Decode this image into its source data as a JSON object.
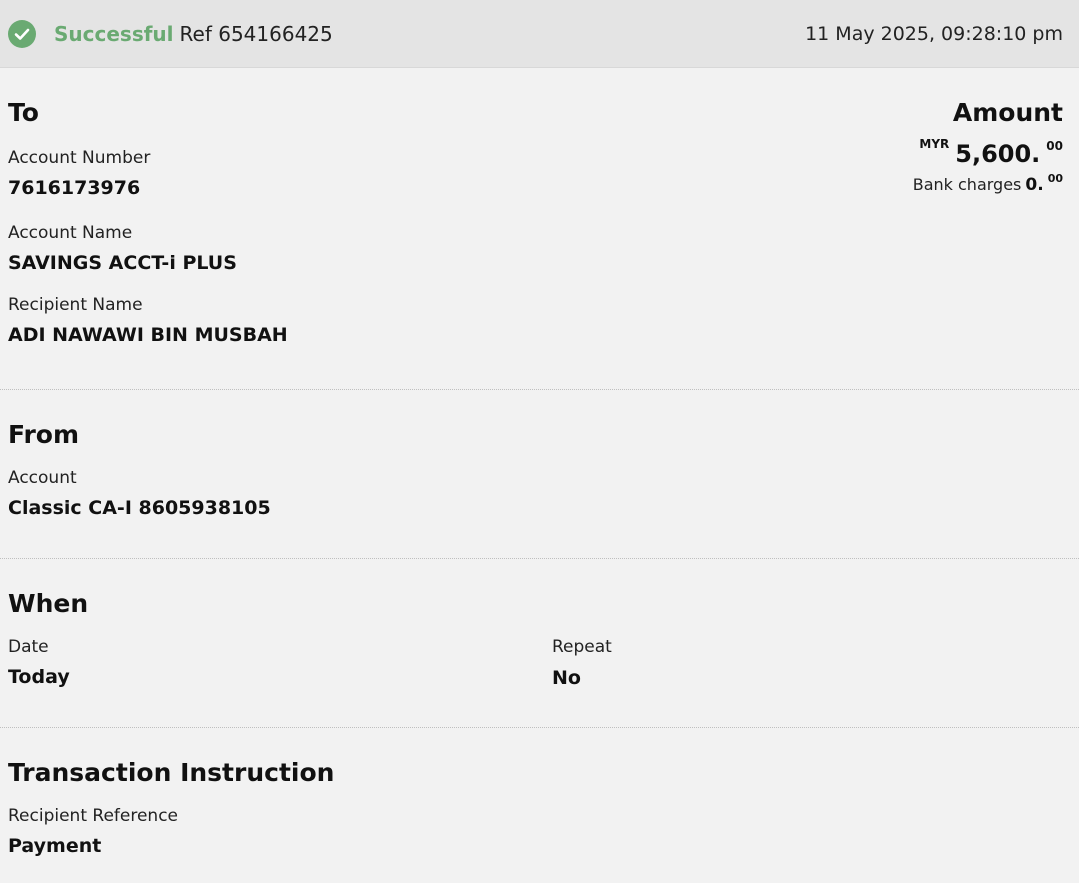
{
  "header": {
    "status": "Successful",
    "ref": "Ref 654166425",
    "datetime": "11 May 2025, 09:28:10 pm",
    "status_color": "#6aaa72",
    "status_icon": "check-circle-icon"
  },
  "to": {
    "title": "To",
    "account_number_label": "Account Number",
    "account_number": "7616173976",
    "account_name_label": "Account Name",
    "account_name": "SAVINGS ACCT-i PLUS",
    "recipient_name_label": "Recipient Name",
    "recipient_name": "ADI NAWAWI BIN MUSBAH"
  },
  "amount": {
    "title": "Amount",
    "currency": "MYR",
    "value": "5,600.",
    "cents": "00",
    "charges_label": "Bank charges",
    "charges_value": "0.",
    "charges_cents": "00"
  },
  "from": {
    "title": "From",
    "account_label": "Account",
    "account": "Classic CA-I 8605938105"
  },
  "when": {
    "title": "When",
    "date_label": "Date",
    "date": "Today",
    "repeat_label": "Repeat",
    "repeat": "No"
  },
  "instruction": {
    "title": "Transaction Instruction",
    "recipient_reference_label": "Recipient Reference",
    "recipient_reference": "Payment"
  }
}
